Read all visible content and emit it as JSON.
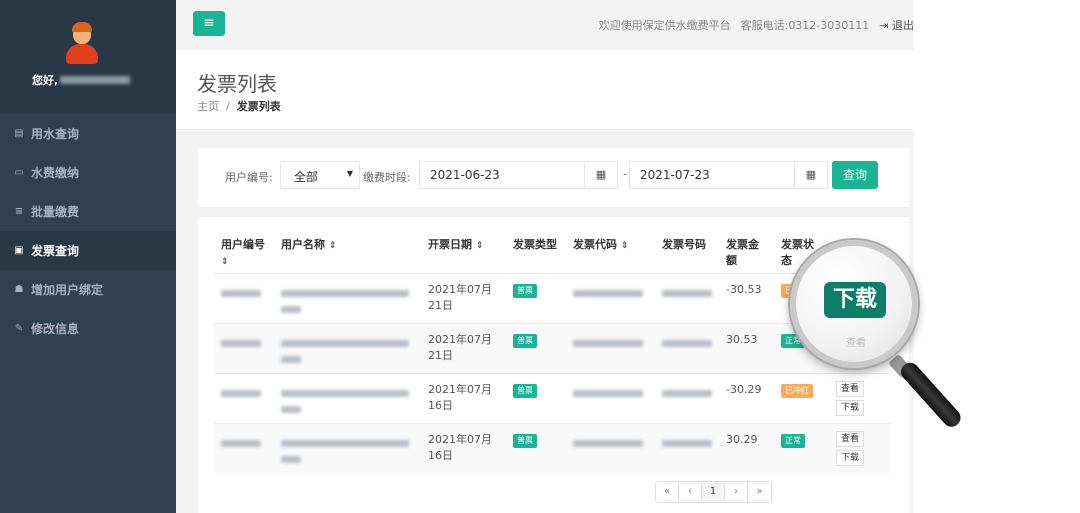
{
  "sidebar": {
    "greeting": "您好,",
    "items": [
      {
        "label": "用水查询",
        "icon": "book-icon",
        "glyph": "▤"
      },
      {
        "label": "水费缴纳",
        "icon": "credit-card-icon",
        "glyph": "▭"
      },
      {
        "label": "批量缴费",
        "icon": "list-icon",
        "glyph": "≡"
      },
      {
        "label": "发票查询",
        "icon": "id-card-icon",
        "glyph": "▣"
      },
      {
        "label": "增加用户绑定",
        "icon": "users-icon",
        "glyph": "☗"
      },
      {
        "label": "修改信息",
        "icon": "edit-icon",
        "glyph": "✎"
      }
    ]
  },
  "header": {
    "menu_glyph": "≡",
    "welcome": "欢迎使用保定供水缴费平台",
    "phone": "客服电话:0312-3030111",
    "logout": "退出",
    "logout_glyph": "⇥"
  },
  "page": {
    "title": "发票列表",
    "breadcrumb_home": "主页",
    "breadcrumb_sep": "/",
    "breadcrumb_current": "发票列表"
  },
  "filter": {
    "user_no_label": "用户编号:",
    "user_no_value": "全部",
    "period_label": "缴费时段:",
    "date_from": "2021-06-23",
    "date_to": "2021-07-23",
    "dash": "-",
    "cal_glyph": "▦",
    "query_label": "查询"
  },
  "table": {
    "columns": [
      "用户编号",
      "用户名称",
      "开票日期",
      "发票类型",
      "发票代码",
      "发票号码",
      "发票金额",
      "发票状态"
    ],
    "sort_glyph": "⇕",
    "rows": [
      {
        "date": "2021年07月21日",
        "type": "普票",
        "amount": "-30.53",
        "status": "已冲红",
        "status_color": "orange"
      },
      {
        "date": "2021年07月21日",
        "type": "普票",
        "amount": "30.53",
        "status": "正常",
        "status_color": "green"
      },
      {
        "date": "2021年07月16日",
        "type": "普票",
        "amount": "-30.29",
        "status": "已冲红",
        "status_color": "orange"
      },
      {
        "date": "2021年07月16日",
        "type": "普票",
        "amount": "30.29",
        "status": "正常",
        "status_color": "green"
      }
    ],
    "view_label": "查看",
    "download_label": "下载"
  },
  "pagination": {
    "first": "«",
    "prev": "‹",
    "page": "1",
    "next": "›",
    "last": "»"
  },
  "magnifier": {
    "label": "下载",
    "ghost": "查看"
  },
  "colors": {
    "accent": "#1ab394",
    "sidebar": "#2f4050",
    "warning": "#f8ac59"
  }
}
